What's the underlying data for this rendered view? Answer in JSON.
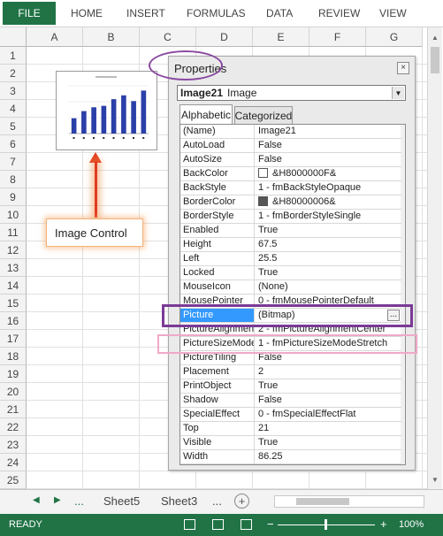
{
  "ribbon": {
    "tabs": [
      "FILE",
      "HOME",
      "INSERT",
      "FORMULAS",
      "DATA",
      "REVIEW",
      "VIEW"
    ]
  },
  "sheet": {
    "columns": [
      "A",
      "B",
      "C",
      "D",
      "E",
      "F",
      "G"
    ],
    "rows": [
      "1",
      "2",
      "3",
      "4",
      "5",
      "6",
      "7",
      "8",
      "9",
      "10",
      "11",
      "12",
      "13",
      "14",
      "15",
      "16",
      "17",
      "18",
      "19",
      "20",
      "21",
      "22",
      "23",
      "24",
      "25"
    ]
  },
  "image_control": {
    "chart_bar_levels": [
      0.32,
      0.47,
      0.55,
      0.58,
      0.72,
      0.8,
      0.68,
      0.9
    ]
  },
  "callout": {
    "label": "Image Control"
  },
  "properties": {
    "title": "Properties",
    "close_glyph": "×",
    "object_name": "Image21",
    "object_type": "Image",
    "tabs": [
      "Alphabetic",
      "Categorized"
    ],
    "rows": [
      {
        "k": "(Name)",
        "v": "Image21"
      },
      {
        "k": "AutoLoad",
        "v": "False"
      },
      {
        "k": "AutoSize",
        "v": "False"
      },
      {
        "k": "BackColor",
        "v": "&H8000000F&",
        "swatch": "#ffffff"
      },
      {
        "k": "BackStyle",
        "v": "1 - fmBackStyleOpaque"
      },
      {
        "k": "BorderColor",
        "v": "&H80000006&",
        "swatch": "#555555"
      },
      {
        "k": "BorderStyle",
        "v": "1 - fmBorderStyleSingle"
      },
      {
        "k": "Enabled",
        "v": "True"
      },
      {
        "k": "Height",
        "v": "67.5"
      },
      {
        "k": "Left",
        "v": "25.5"
      },
      {
        "k": "Locked",
        "v": "True"
      },
      {
        "k": "MouseIcon",
        "v": "(None)"
      },
      {
        "k": "MousePointer",
        "v": "0 - fmMousePointerDefault"
      },
      {
        "k": "Picture",
        "v": "(Bitmap)",
        "selected": true,
        "dots": "..."
      },
      {
        "k": "PictureAlignment",
        "v": "2 - fmPictureAlignmentCenter"
      },
      {
        "k": "PictureSizeMode",
        "v": "1 - fmPictureSizeModeStretch"
      },
      {
        "k": "PictureTiling",
        "v": "False"
      },
      {
        "k": "Placement",
        "v": "2"
      },
      {
        "k": "PrintObject",
        "v": "True"
      },
      {
        "k": "Shadow",
        "v": "False"
      },
      {
        "k": "SpecialEffect",
        "v": "0 - fmSpecialEffectFlat"
      },
      {
        "k": "Top",
        "v": "21"
      },
      {
        "k": "Visible",
        "v": "True"
      },
      {
        "k": "Width",
        "v": "86.25"
      }
    ]
  },
  "sheetbar": {
    "prev_arrow": "◀",
    "next_arrow": "▶",
    "ellipsis_left": "...",
    "tabs": [
      "Sheet5",
      "Sheet3"
    ],
    "ellipsis_right": "...",
    "add_glyph": "+"
  },
  "statusbar": {
    "status": "READY",
    "zoom_minus": "−",
    "zoom_plus": "+",
    "zoom": "100%"
  },
  "colors": {
    "excel_green": "#217346",
    "selection_blue": "#3399ff",
    "highlight_purple": "#7a3a96",
    "highlight_pink": "#f0a8c8",
    "arrow_red": "#e03c1f"
  }
}
